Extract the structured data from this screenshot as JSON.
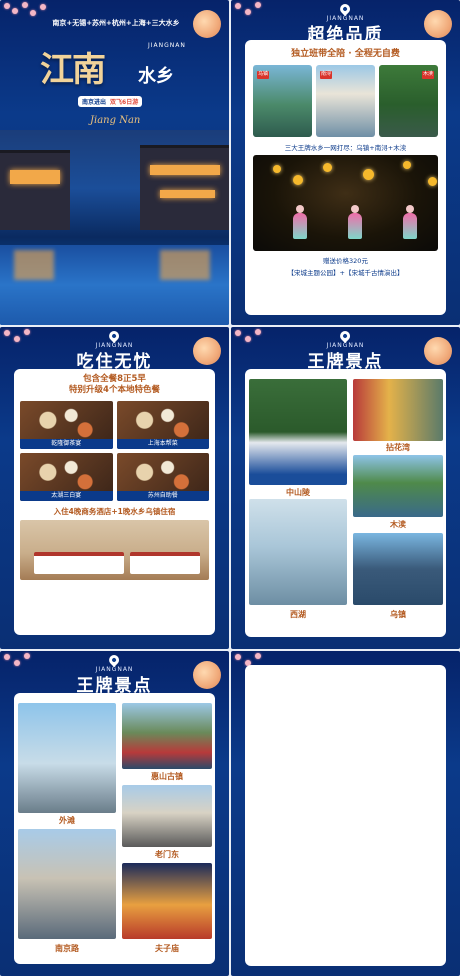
{
  "p1": {
    "cities": "南京+无锡+苏州+杭州+上海+三大水乡",
    "title_big": "江南",
    "title_small": "水乡",
    "brand": "JIANGNAN",
    "tag_left": "南京进出",
    "tag_right": "双飞6日游",
    "script": "Jiang Nan"
  },
  "p2": {
    "brand": "JIANGNAN",
    "title": "超绝品质",
    "sub": "独立班带全陪 · 全程无自费",
    "tags": [
      "乌镇",
      "南浔",
      "木渎"
    ],
    "line": "三大王牌水乡一网打尽：乌镇+南浔+木渎",
    "gift_price": "赠送价格320元",
    "gift_items": "【宋城主题公园】+【宋城千古情演出】"
  },
  "p3": {
    "brand": "JIANGNAN",
    "title": "吃住无忧",
    "meal1": "包含全餐8正5早",
    "meal2": "特别升级4个本地特色餐",
    "foods": [
      "乾隆御茶宴",
      "上海本帮菜",
      "太湖三白宴",
      "苏州自助餐"
    ],
    "hotel": "入住4晚商务酒店+1晚水乡乌镇住宿"
  },
  "p4": {
    "brand": "JIANGNAN",
    "title": "王牌景点",
    "spots": [
      "中山陵",
      "拈花湾",
      "木渎",
      "西湖",
      "乌镇"
    ]
  },
  "p5": {
    "brand": "JIANGNAN",
    "title": "王牌景点",
    "spots": [
      "外滩",
      "惠山古镇",
      "老门东",
      "南京路",
      "夫子庙"
    ]
  },
  "colors": {
    "navy": "#0b3a8a",
    "accent": "#b35a20",
    "red": "#d9342b",
    "gold": "#f1d39a"
  }
}
